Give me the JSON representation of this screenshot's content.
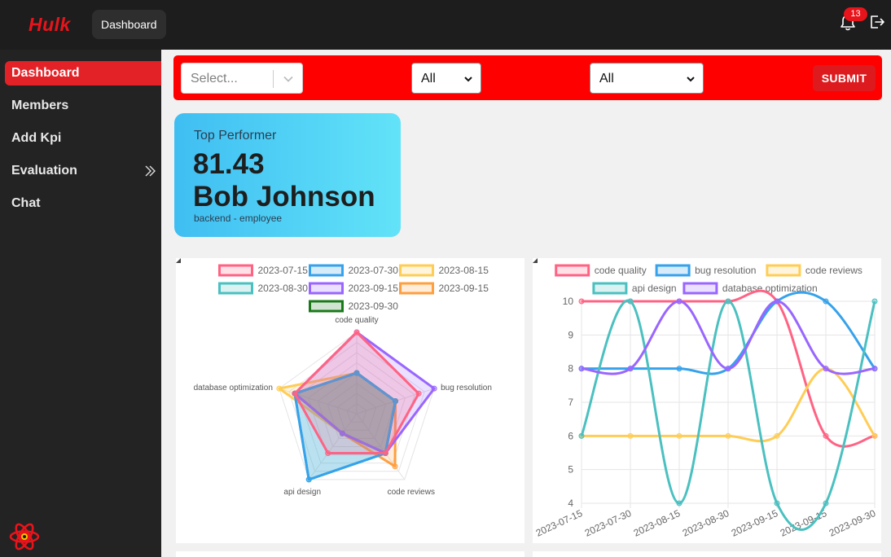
{
  "header": {
    "brand": "Hulk",
    "breadcrumb": "Dashboard",
    "notification_count": "13"
  },
  "sidebar": {
    "items": [
      {
        "label": "Dashboard",
        "active": true
      },
      {
        "label": "Members"
      },
      {
        "label": "Add Kpi"
      },
      {
        "label": "Evaluation",
        "has_submenu": true
      },
      {
        "label": "Chat"
      }
    ]
  },
  "filters": {
    "select_placeholder": "Select...",
    "filter2_value": "All",
    "filter3_value": "All",
    "submit_label": "SUBMIT"
  },
  "top_performer": {
    "title": "Top Performer",
    "score": "81.43",
    "name": "Bob Johnson",
    "subtitle": "backend - employee"
  },
  "colors": {
    "brand": "#e8141b",
    "filter_bar": "#ff0000",
    "pink": "#ff6384",
    "blue": "#36a2eb",
    "yellow": "#ffcd56",
    "teal": "#4bc0c0",
    "purple": "#9966ff",
    "orange": "#ff9f40",
    "green": "#1a7a1a"
  },
  "chart_data": [
    {
      "type": "radar",
      "categories": [
        "code quality",
        "bug resolution",
        "code reviews",
        "api design",
        "database optimization"
      ],
      "rmin": 0,
      "rmax": 10,
      "legend_position": "top",
      "series": [
        {
          "name": "2023-07-15",
          "color": "#ff6384",
          "values": [
            10,
            8,
            6,
            6,
            8
          ]
        },
        {
          "name": "2023-07-30",
          "color": "#36a2eb",
          "values": [
            5,
            5,
            6,
            10,
            8
          ]
        },
        {
          "name": "2023-08-15",
          "color": "#ffcd56",
          "values": [
            5,
            5,
            6,
            3,
            10
          ]
        },
        {
          "name": "2023-08-30",
          "color": "#4bc0c0",
          "values": [
            5,
            5,
            6,
            10,
            8
          ]
        },
        {
          "name": "2023-09-15",
          "color": "#9966ff",
          "values": [
            10,
            10,
            6,
            3,
            8
          ]
        },
        {
          "name": "2023-09-15",
          "color": "#ff9f40",
          "values": [
            5,
            5,
            8,
            3,
            8
          ]
        },
        {
          "name": "2023-09-30",
          "color": "#1a7a1a",
          "values": [
            5,
            5,
            6,
            3,
            8
          ]
        }
      ]
    },
    {
      "type": "line",
      "x": [
        "2023-07-15",
        "2023-07-30",
        "2023-08-15",
        "2023-08-30",
        "2023-09-15",
        "2023-09-15",
        "2023-09-30"
      ],
      "ylim": [
        4,
        10
      ],
      "yticks": [
        4,
        5,
        6,
        7,
        8,
        9,
        10
      ],
      "grid": true,
      "legend_position": "top",
      "series": [
        {
          "name": "code quality",
          "color": "#ff6384",
          "values": [
            10,
            10,
            10,
            10,
            10,
            6,
            6
          ]
        },
        {
          "name": "bug resolution",
          "color": "#36a2eb",
          "values": [
            8,
            8,
            8,
            8,
            10,
            10,
            8
          ]
        },
        {
          "name": "code reviews",
          "color": "#ffcd56",
          "values": [
            6,
            6,
            6,
            6,
            6,
            8,
            6
          ]
        },
        {
          "name": "api design",
          "color": "#4bc0c0",
          "values": [
            6,
            10,
            4,
            10,
            4,
            4,
            10
          ]
        },
        {
          "name": "database optimization",
          "color": "#9966ff",
          "values": [
            8,
            8,
            10,
            8,
            10,
            8,
            8
          ]
        }
      ]
    }
  ]
}
